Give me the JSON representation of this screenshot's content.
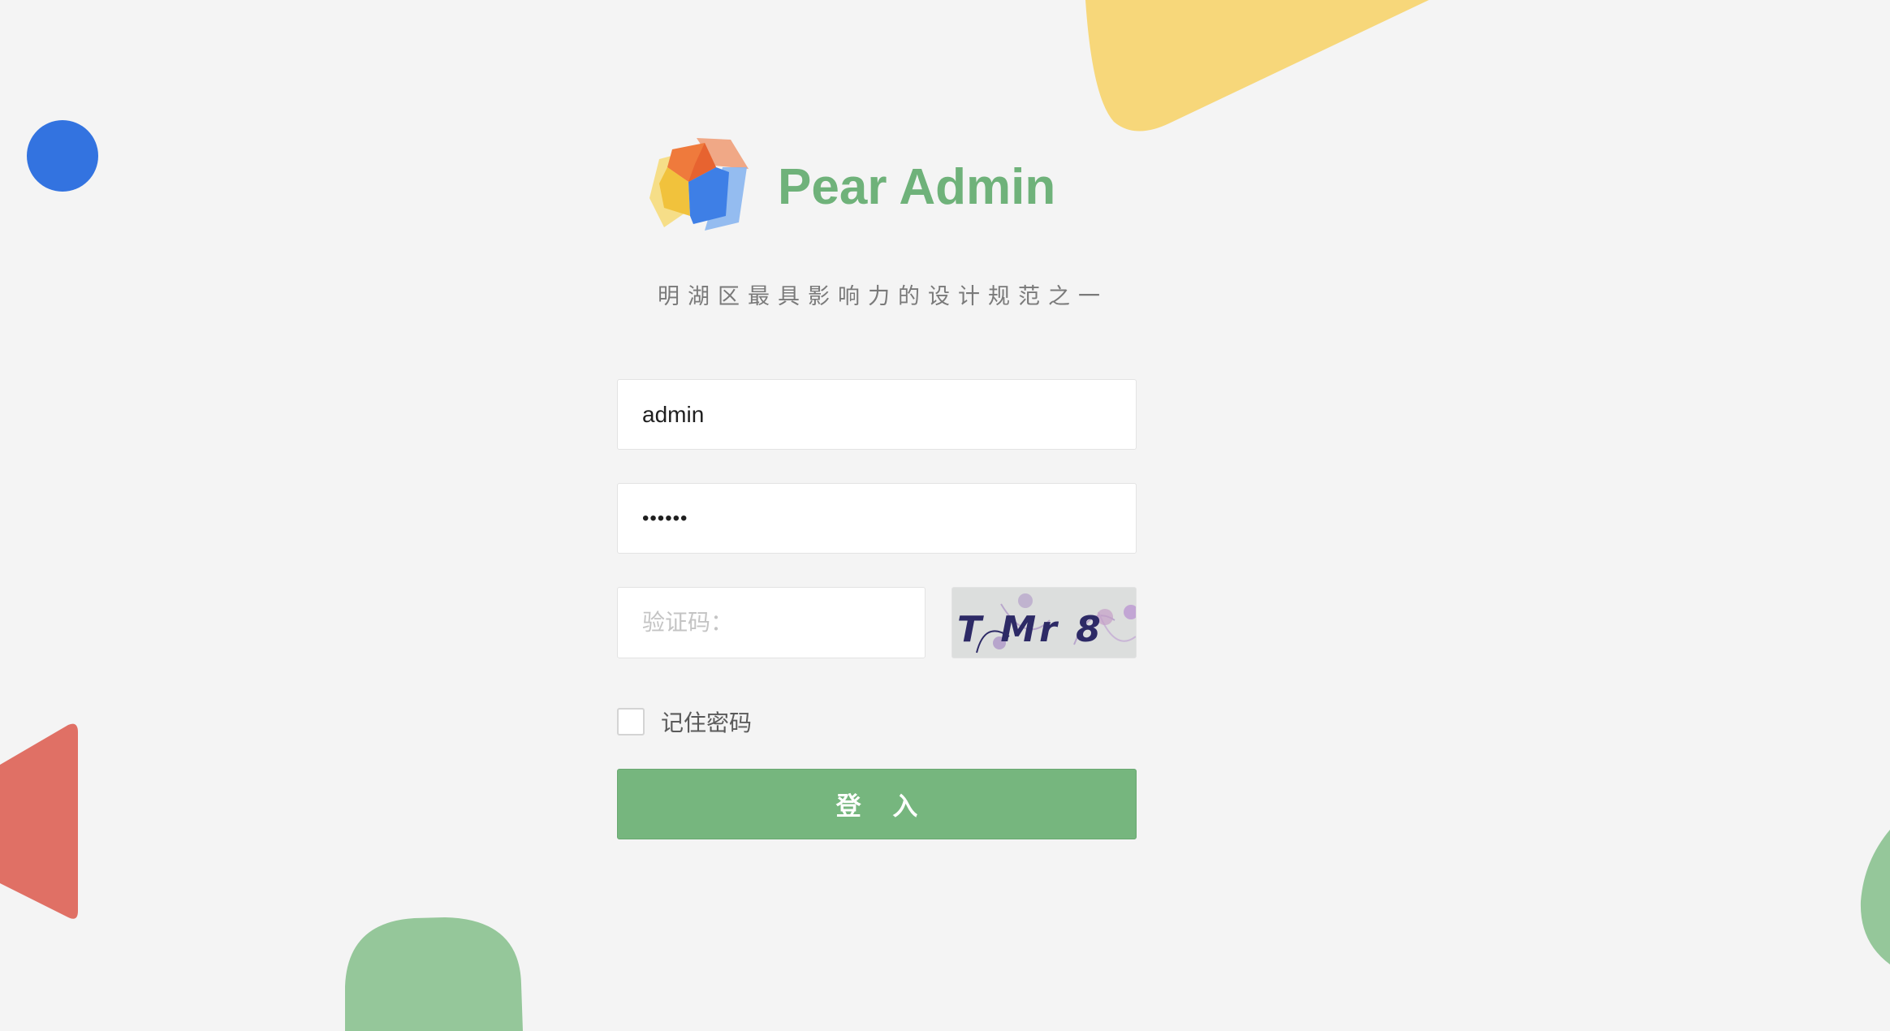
{
  "brand": {
    "title": "Pear Admin",
    "subtitle": "明湖区最具影响力的设计规范之一",
    "logo_icon": "cube-logo-icon",
    "title_color": "#6fb27a"
  },
  "login_form": {
    "username": {
      "value": "admin"
    },
    "password": {
      "value": "••••••"
    },
    "captcha": {
      "placeholder": "验证码：",
      "value": "",
      "image_text": "T Mr 8"
    },
    "remember": {
      "label": "记住密码",
      "checked": false
    },
    "submit_label": "登 入"
  },
  "theme": {
    "background": "#f4f4f4",
    "accent_green": "#76b67e",
    "decor_blue": "#3373e0",
    "decor_yellow": "#f7d77a",
    "decor_red": "#e07065",
    "decor_green": "#95c79a"
  }
}
